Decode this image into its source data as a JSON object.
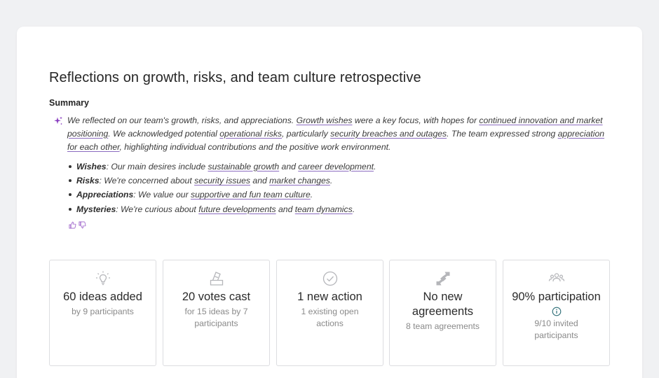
{
  "page": {
    "title": "Reflections on growth, risks, and team culture retrospective",
    "summary_heading": "Summary"
  },
  "summary": {
    "p1": "We reflected on our team's growth, risks, and appreciations. ",
    "l1": "Growth wishes",
    "p2": " were a key focus, with hopes for ",
    "l2": "continued innovation and market positioning",
    "p3": ". We acknowledged potential ",
    "l3": "operational risks",
    "p4": ", particularly ",
    "l4": "security breaches and outages",
    "p5": ". The team expressed strong ",
    "l5": "appreciation for each other",
    "p6": ", highlighting individual contributions and the positive work environment."
  },
  "bullets": [
    {
      "label": "Wishes",
      "pre": ": Our main desires include ",
      "link1": "sustainable growth",
      "mid": " and ",
      "link2": "career development",
      "end": "."
    },
    {
      "label": "Risks",
      "pre": ": We're concerned about ",
      "link1": "security issues",
      "mid": " and ",
      "link2": "market changes",
      "end": "."
    },
    {
      "label": "Appreciations",
      "pre": ": We value our ",
      "link1": "supportive and fun team culture",
      "mid": "",
      "link2": "",
      "end": "."
    },
    {
      "label": "Mysteries",
      "pre": ": We're curious about ",
      "link1": "future developments",
      "mid": " and ",
      "link2": "team dynamics",
      "end": "."
    }
  ],
  "stats": [
    {
      "icon": "lightbulb-icon",
      "main": "60 ideas added",
      "sub": "by 9 participants"
    },
    {
      "icon": "ballot-box-icon",
      "main": "20 votes cast",
      "sub": "for 15 ideas by 7 participants"
    },
    {
      "icon": "check-circle-icon",
      "main": "1 new action",
      "sub": "1 existing open actions"
    },
    {
      "icon": "handshake-icon",
      "main": "No new agreements",
      "sub": "8 team agreements"
    },
    {
      "icon": "people-icon",
      "main": "90% participation",
      "sub": "9/10 invited participants"
    }
  ],
  "colors": {
    "accent": "#8a3fc1",
    "link_underline": "#8a6bbf",
    "icon_gray": "#b5b6ba",
    "info_teal": "#2f6f78"
  }
}
